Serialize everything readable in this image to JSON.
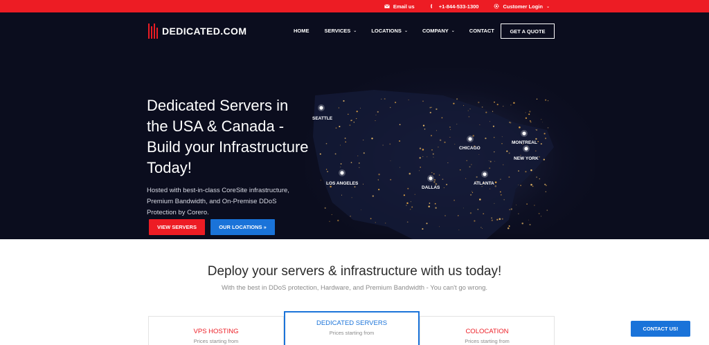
{
  "topbar": {
    "email_label": "Email us",
    "phone_label": "+1-844-533-1300",
    "login_label": "Customer Login",
    "icons": [
      "email-icon",
      "phone-icon",
      "gear-icon",
      "chevron-down-icon"
    ]
  },
  "brand": {
    "name": "DEDICATED.COM",
    "accent_color": "#ed1c24",
    "blue_color": "#1a73d9",
    "hero_bg": "#0b0d1e"
  },
  "nav": {
    "items": [
      {
        "label": "HOME",
        "dropdown": false
      },
      {
        "label": "SERVICES",
        "dropdown": true
      },
      {
        "label": "LOCATIONS",
        "dropdown": true
      },
      {
        "label": "COMPANY",
        "dropdown": true
      },
      {
        "label": "CONTACT",
        "dropdown": false
      }
    ],
    "cta_label": "GET A QUOTE"
  },
  "hero": {
    "title": "Dedicated Servers in the USA & Canada - Build your Infrastructure Today!",
    "subtitle": "Hosted with best-in-class CoreSite infrastructure, Premium Bandwidth, and On-Premise DDoS Protection by Corero.",
    "primary_button": "VIEW SERVERS",
    "secondary_button": "OUR LOCATIONS »",
    "cities": [
      "SEATTLE",
      "LOS ANGELES",
      "DALLAS",
      "CHICAGO",
      "ATLANTA",
      "MONTREAL",
      "NEW YORK"
    ]
  },
  "deploy": {
    "title": "Deploy your servers & infrastructure with us today!",
    "subtitle": "With the best in DDoS protection, Hardware, and Premium Bandwidth - You can't go wrong."
  },
  "cards": [
    {
      "title": "VPS HOSTING",
      "price_label": "Prices starting from"
    },
    {
      "title": "DEDICATED SERVERS",
      "price_label": "Prices starting from",
      "selected": true
    },
    {
      "title": "COLOCATION",
      "price_label": "Prices starting from"
    }
  ],
  "contact_button": "CONTACT US!"
}
